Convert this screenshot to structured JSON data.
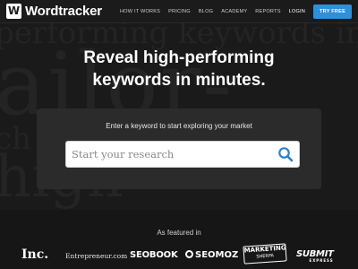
{
  "header": {
    "logo_text": "Wordtracker",
    "logo_mark": "W",
    "nav": [
      "HOW IT WORKS",
      "PRICING",
      "BLOG",
      "ACADEMY",
      "REPORTS"
    ],
    "login": "LOGIN",
    "cta": "TRY FREE",
    "cta_color": "#2f8fd8"
  },
  "hero": {
    "background_words": [
      "performing keywords in mi",
      "ailor-",
      "ch ki",
      "high-"
    ],
    "headline_line1": "Reveal high-performing",
    "headline_line2": "keywords in minutes.",
    "search_prompt": "Enter a keyword to start exploring your market",
    "search_placeholder": "Start your research",
    "search_icon": "search-icon"
  },
  "featured": {
    "label": "As featured in",
    "publications": {
      "inc": "Inc.",
      "entrepreneur": "Entrepreneur.com",
      "seobook": "SEOBOOK",
      "seomoz": "SEOMOZ",
      "marketing_top": "MARKETING",
      "marketing_bottom": "SHERPA",
      "submit": "SUBMIT",
      "submit_sub": "EXPRESS"
    }
  }
}
